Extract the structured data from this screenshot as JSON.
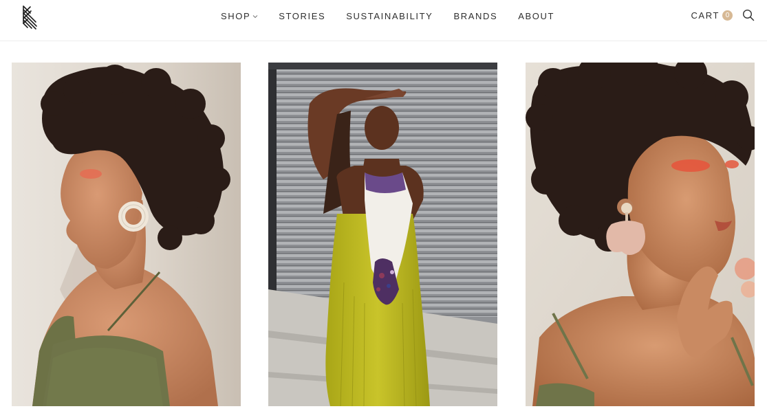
{
  "brand": {
    "logo_icon": "stacked-lines-logo-icon"
  },
  "nav": {
    "items": [
      {
        "label": "SHOP",
        "has_dropdown": true
      },
      {
        "label": "STORIES"
      },
      {
        "label": "SUSTAINABILITY"
      },
      {
        "label": "BRANDS"
      },
      {
        "label": "ABOUT"
      }
    ]
  },
  "cart": {
    "label": "CART",
    "count": "0",
    "badge_color": "#d7b995"
  },
  "search": {
    "icon": "search-icon"
  },
  "gallery": {
    "images": [
      {
        "description": "model-profile-hoop-earring"
      },
      {
        "description": "model-yellow-beaded-dress"
      },
      {
        "description": "model-petal-earring"
      }
    ]
  }
}
